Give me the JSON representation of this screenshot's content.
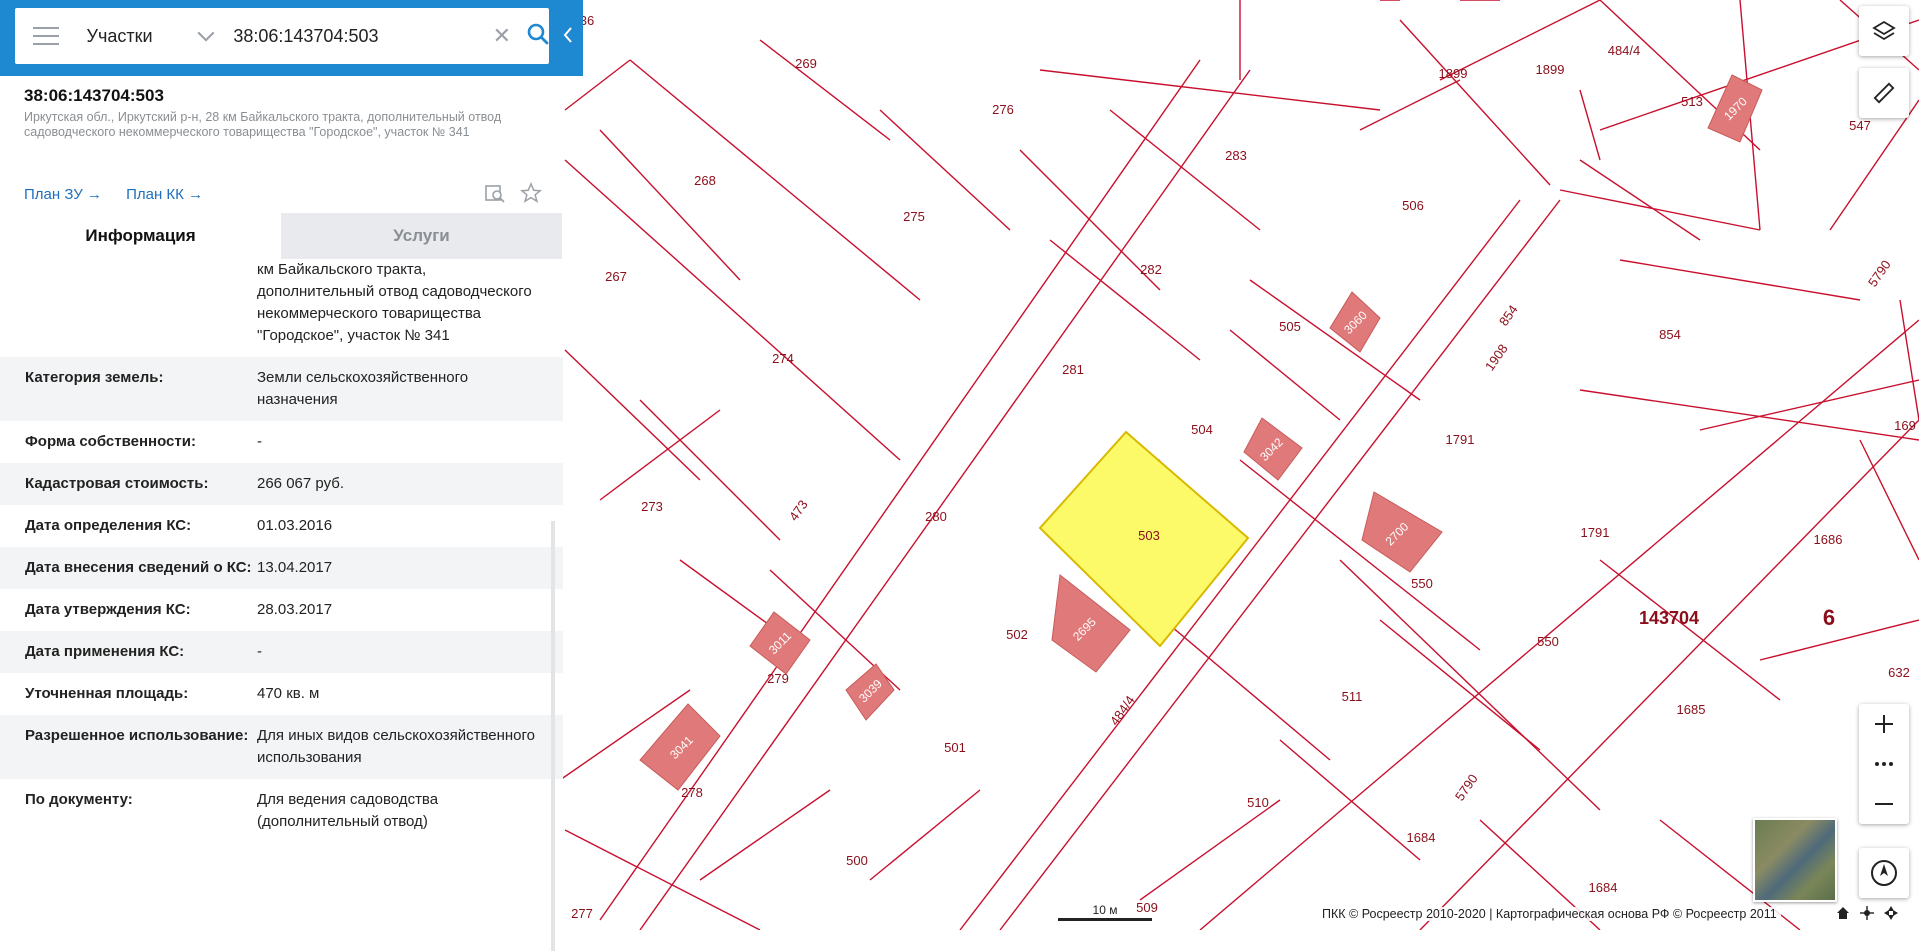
{
  "search": {
    "category": "Участки",
    "query": "38:06:143704:503"
  },
  "parcel": {
    "number": "38:06:143704:503",
    "address": "Иркутская обл., Иркутский р-н, 28 км Байкальского тракта, дополнительный отвод садоводческого некоммерческого товарищества \"Городское\", участок № 341",
    "plan_zu": "План ЗУ →",
    "plan_kk": "План КК →"
  },
  "tabs": {
    "info": "Информация",
    "services": "Услуги"
  },
  "rows": [
    {
      "key": "",
      "value": "км Байкальского тракта, дополнительный отвод садоводческого некоммерческого товарищества \"Городское\", участок № 341"
    },
    {
      "key": "Категория земель:",
      "value": "Земли сельскохозяйственного назначения"
    },
    {
      "key": "Форма собственности:",
      "value": "-"
    },
    {
      "key": "Кадастровая стоимость:",
      "value": "266 067 руб."
    },
    {
      "key": "Дата определения КС:",
      "value": "01.03.2016"
    },
    {
      "key": "Дата внесения сведений о КС:",
      "value": "13.04.2017"
    },
    {
      "key": "Дата утверждения КС:",
      "value": "28.03.2017"
    },
    {
      "key": "Дата применения КС:",
      "value": "-"
    },
    {
      "key": "Уточненная площадь:",
      "value": "470 кв. м"
    },
    {
      "key": "Разрешенное использование:",
      "value": "Для иных видов сельскохозяйственного использования"
    },
    {
      "key": "По документу:",
      "value": "Для ведения садоводства (дополнительный отвод)"
    }
  ],
  "map": {
    "selected_parcel": "503",
    "quarter": "143704",
    "district": "6",
    "labels": [
      "36",
      "269",
      "276",
      "1899",
      "1899",
      "484/4",
      "513",
      "547",
      "268",
      "275",
      "283",
      "506",
      "267",
      "282",
      "505",
      "854",
      "274",
      "281",
      "504",
      "1791",
      "273",
      "280",
      "503",
      "1791",
      "1686",
      "169",
      "550",
      "550",
      "143704",
      "6",
      "632",
      "279",
      "502",
      "511",
      "1685",
      "501",
      "510",
      "1684",
      "278",
      "500",
      "1684",
      "277",
      "509",
      "5790",
      "5790",
      "473",
      "484/4",
      "854",
      "1908"
    ],
    "buildings": [
      "1970",
      "3060",
      "3042",
      "2700",
      "2695",
      "3011",
      "3039",
      "3041"
    ],
    "scale_label": "10 м",
    "copyright": "ПКК © Росреестр 2010-2020 | Картографическая основа РФ © Росреестр 2011"
  },
  "colors": {
    "accent": "#1e88d1",
    "boundary": "#c8102e",
    "selected_fill": "#fdfa6a",
    "building_fill": "#e07a7a",
    "label": "#8b0f1a"
  }
}
